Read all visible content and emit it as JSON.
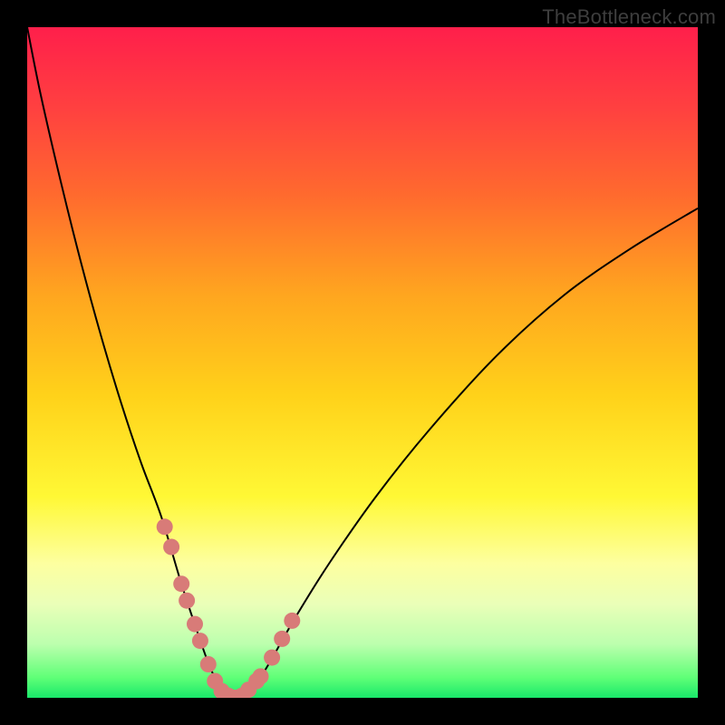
{
  "watermark": "TheBottleneck.com",
  "colors": {
    "gradient_top": "#ff1f4b",
    "gradient_bottom": "#19e86a",
    "curve": "#000000",
    "dots": "#d87b78",
    "frame": "#000000"
  },
  "chart_data": {
    "type": "line",
    "title": "",
    "xlabel": "",
    "ylabel": "",
    "xlim": [
      0,
      100
    ],
    "ylim": [
      0,
      100
    ],
    "series": [
      {
        "name": "bottleneck-curve",
        "x": [
          0,
          2,
          5,
          8,
          11,
          14,
          17,
          20,
          23,
          26,
          27.5,
          29,
          30,
          31,
          32,
          34,
          36,
          40,
          45,
          52,
          60,
          70,
          80,
          90,
          100
        ],
        "y": [
          100,
          90,
          77,
          65,
          54,
          44,
          35,
          27,
          17,
          8,
          4,
          1.5,
          0.3,
          0,
          0.3,
          2,
          5,
          12,
          20,
          30,
          40,
          51,
          60,
          67,
          73
        ]
      }
    ],
    "markers": {
      "name": "highlighted-data-points",
      "x": [
        20.5,
        21.5,
        23.0,
        23.8,
        25.0,
        25.8,
        27.0,
        28.0,
        29.0,
        30.0,
        31.0,
        32.0,
        33.0,
        34.2,
        34.8,
        36.5,
        38.0,
        39.5
      ],
      "y": [
        25.5,
        22.5,
        17.0,
        14.5,
        11.0,
        8.5,
        5.0,
        2.5,
        1.0,
        0.3,
        0.0,
        0.3,
        1.2,
        2.5,
        3.2,
        6.0,
        8.8,
        11.5
      ]
    }
  }
}
